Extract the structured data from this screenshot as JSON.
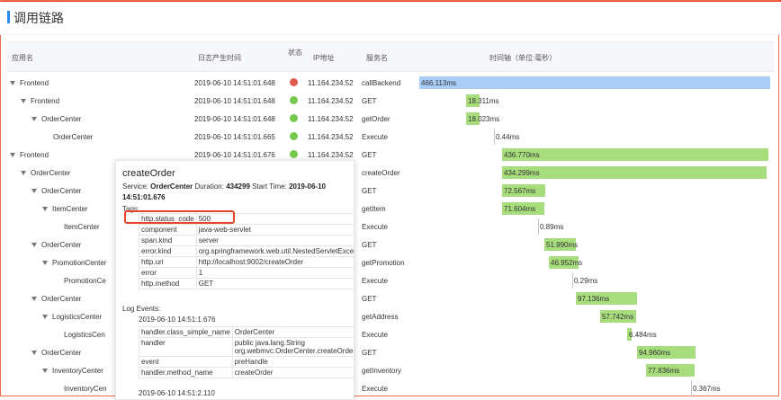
{
  "page": {
    "title": "调用链路"
  },
  "colors": {
    "blue_bar": "#a9cdf7",
    "green_bar": "#a8dd7e",
    "status_error": "#e05b4b",
    "status_ok": "#76c94f",
    "tick": "#c7c7c7"
  },
  "table": {
    "headers": {
      "app_name": "应用名",
      "log_time": "日志产生时间",
      "status": "状态",
      "ip": "IP地址",
      "service": "服务名",
      "timeline": "时间轴（单位:毫秒）"
    },
    "rows": [
      {
        "app": "Frontend",
        "caret": true,
        "indent": 0,
        "time": "2019-06-10 14:51:01.648",
        "status": "error",
        "ip": "11.164.234.52",
        "service": "callBackend",
        "duration": "466.113ms"
      },
      {
        "app": "Frontend",
        "caret": true,
        "indent": 1,
        "time": "2019-06-10 14:51:01.648",
        "status": "ok",
        "ip": "11.164.234.52",
        "service": "GET",
        "duration": "18.311ms"
      },
      {
        "app": "OrderCenter",
        "caret": true,
        "indent": 2,
        "time": "2019-06-10 14:51:01.648",
        "status": "ok",
        "ip": "11.164.234.52",
        "service": "getOrder",
        "duration": "18.023ms"
      },
      {
        "app": "OrderCenter",
        "caret": false,
        "indent": 3,
        "time": "2019-06-10 14:51:01.665",
        "status": "ok",
        "ip": "11.164.234.52",
        "service": "Execute",
        "duration": "0.44ms"
      },
      {
        "app": "Frontend",
        "caret": true,
        "indent": 0,
        "time": "2019-06-10 14:51:01.676",
        "status": "ok",
        "ip": "11.164.234.52",
        "service": "GET",
        "duration": "436.770ms"
      },
      {
        "app": "OrderCenter",
        "caret": true,
        "indent": 1,
        "time": "",
        "status": "",
        "ip": "",
        "service": "createOrder",
        "duration": "434.299ms"
      },
      {
        "app": "OrderCenter",
        "caret": true,
        "indent": 2,
        "time": "",
        "status": "",
        "ip": "",
        "service": "GET",
        "duration": "72.567ms"
      },
      {
        "app": "ItemCenter",
        "caret": true,
        "indent": 3,
        "time": "",
        "status": "",
        "ip": "",
        "service": "getItem",
        "duration": "71.604ms"
      },
      {
        "app": "ItemCenter",
        "caret": false,
        "indent": 4,
        "time": "",
        "status": "",
        "ip": "",
        "service": "Execute",
        "duration": "0.89ms"
      },
      {
        "app": "OrderCenter",
        "caret": true,
        "indent": 2,
        "time": "",
        "status": "",
        "ip": "",
        "service": "GET",
        "duration": "51.990ms"
      },
      {
        "app": "PromotionCenter",
        "caret": true,
        "indent": 3,
        "time": "",
        "status": "",
        "ip": "",
        "service": "getPromotion",
        "duration": "46.952ms"
      },
      {
        "app": "PromotionCe",
        "caret": false,
        "indent": 4,
        "time": "",
        "status": "",
        "ip": "",
        "service": "Execute",
        "duration": "0.29ms"
      },
      {
        "app": "OrderCenter",
        "caret": true,
        "indent": 2,
        "time": "",
        "status": "",
        "ip": "",
        "service": "GET",
        "duration": "97.136ms"
      },
      {
        "app": "LogisticsCenter",
        "caret": true,
        "indent": 3,
        "time": "",
        "status": "",
        "ip": "",
        "service": "getAddress",
        "duration": "57.742ms"
      },
      {
        "app": "LogisticsCen",
        "caret": false,
        "indent": 4,
        "time": "",
        "status": "",
        "ip": "",
        "service": "Execute",
        "duration": "6.484ms"
      },
      {
        "app": "OrderCenter",
        "caret": true,
        "indent": 2,
        "time": "",
        "status": "",
        "ip": "",
        "service": "GET",
        "duration": "94.960ms"
      },
      {
        "app": "InventoryCenter",
        "caret": true,
        "indent": 3,
        "time": "",
        "status": "",
        "ip": "",
        "service": "getInventory",
        "duration": "77.836ms"
      },
      {
        "app": "InventoryCen",
        "caret": false,
        "indent": 4,
        "time": "",
        "status": "",
        "ip": "",
        "service": "Execute",
        "duration": "0.367ms"
      }
    ]
  },
  "popup": {
    "title": "createOrder",
    "service_label": "Service:",
    "service_value": "OrderCenter",
    "duration_label": "Duration:",
    "duration_value": "434299",
    "start_label": "Start Time:",
    "start_value_a": "2019-06-10",
    "start_value_b": "14:51:01.676",
    "tags_label": "Tags:",
    "tags": [
      {
        "k": "http.status_code",
        "v": "500"
      },
      {
        "k": "component",
        "v": "java-web-servlet"
      },
      {
        "k": "span.kind",
        "v": "server"
      },
      {
        "k": "error.kind",
        "v": "org.springframework.web.util.NestedServletException"
      },
      {
        "k": "http.uri",
        "v": "http://localhost:9002/createOrder"
      },
      {
        "k": "error",
        "v": "1"
      },
      {
        "k": "http.method",
        "v": "GET"
      }
    ],
    "log_events_label": "Log Events:",
    "log1_time": "2019-06-10 14:51:1.676",
    "log1": [
      {
        "k": "handler.class_simple_name",
        "v": "OrderCenter"
      },
      {
        "k": "handler",
        "v": "public java.lang.String org.webmvc.OrderCenter.createOrder(int)"
      },
      {
        "k": "event",
        "v": "preHandle"
      },
      {
        "k": "handler.method_name",
        "v": "createOrder"
      }
    ],
    "log2_time": "2019-06-10 14:51:2.110"
  }
}
